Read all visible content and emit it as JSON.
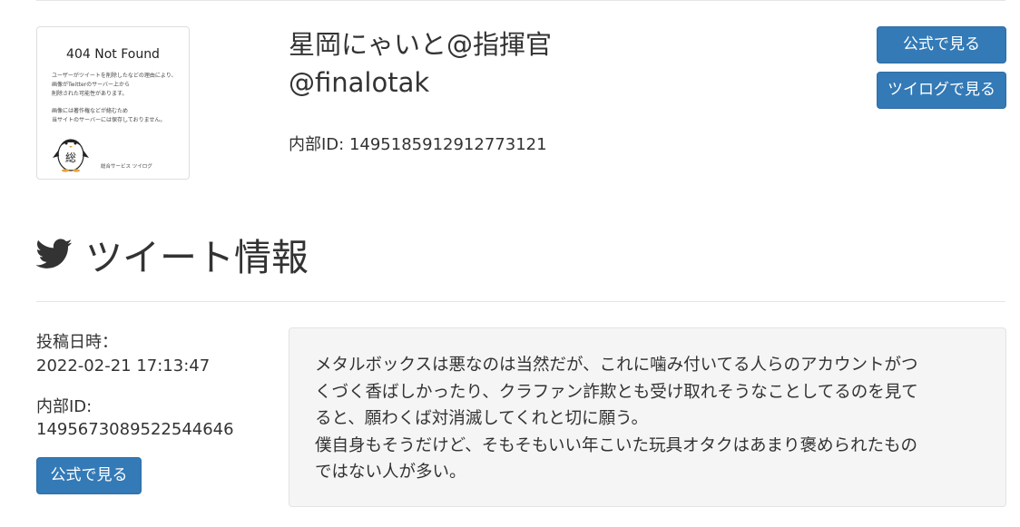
{
  "profile": {
    "image": {
      "title": "404 Not Found",
      "lines": [
        "ユーザーがツイートを削除したなどの理由により、",
        "画像がTwitterのサーバー上から",
        "削除された可能性があります。",
        "画像には著作権などが絡むため",
        "当サイトのサーバーには保存しておりません。"
      ],
      "mascot_char": "総",
      "footer": "総合サービス ツイログ"
    },
    "name": "星岡にゃいと@指揮官",
    "handle": "@finalotak",
    "id_text": "内部ID: 1495185912912773121",
    "btn_official": "公式で見る",
    "btn_twilog": "ツイログで見る"
  },
  "tweet": {
    "section_title": "ツイート情報",
    "posted_label": "投稿日時：",
    "posted_value": "2022-02-21 17:13:47",
    "id_label": "内部ID:",
    "id_value": "1495673089522544646",
    "btn_official": "公式で見る",
    "text_lines": [
      "メタルボックスは悪なのは当然だが、これに噛み付いてる人らのアカウントがつ",
      "くづく香ばしかったり、クラファン詐欺とも受け取れそうなことしてるのを見て",
      "ると、願わくば対消滅してくれと切に願う。",
      "僕自身もそうだけど、そもそもいい年こいた玩具オタクはあまり褒められたもの",
      "ではない人が多い。"
    ]
  },
  "colors": {
    "button": "#337ab7",
    "tweet_bg": "#f5f5f5"
  },
  "icons": {
    "section": "twitter-bird-icon"
  }
}
